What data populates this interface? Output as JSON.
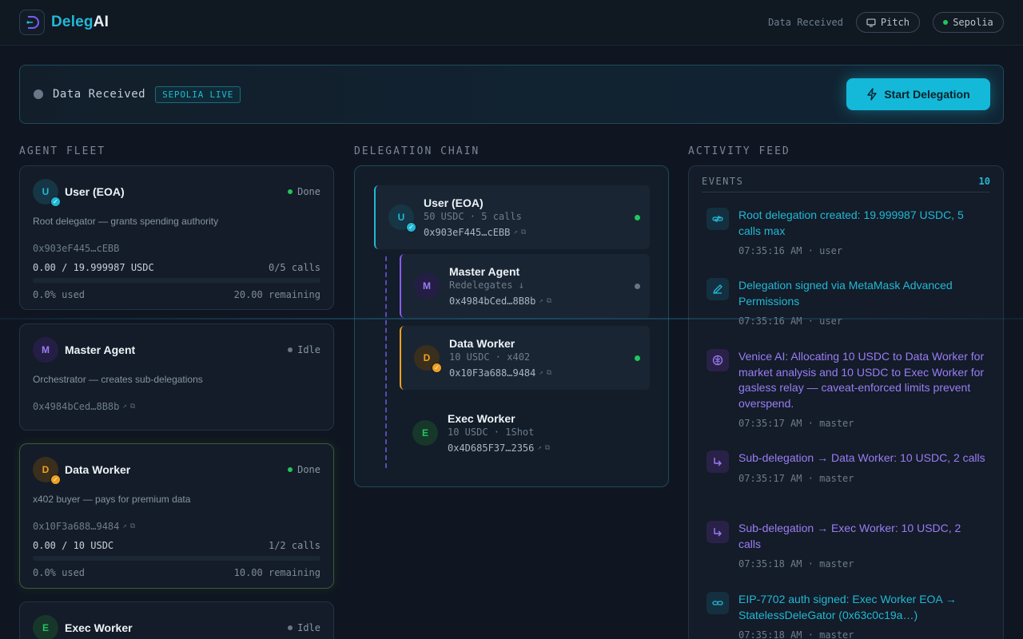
{
  "app": {
    "brand_part1": "Deleg",
    "brand_part2": "AI",
    "header_status": "Data Received",
    "pitch_label": "Pitch",
    "network_label": "Sepolia"
  },
  "status_bar": {
    "text": "Data Received",
    "badge": "SEPOLIA LIVE",
    "start_button": "Start Delegation"
  },
  "sections": {
    "fleet": "AGENT FLEET",
    "chain": "DELEGATION CHAIN",
    "feed": "ACTIVITY FEED"
  },
  "fleet": [
    {
      "initial": "U",
      "name": "User (EOA)",
      "status": "Done",
      "desc": "Root delegator — grants spending authority",
      "addr": "0x903eF445…cEBB",
      "amount": "0.00 / 19.999987 USDC",
      "calls": "0/5 calls",
      "used": "0.0% used",
      "remaining": "20.00 remaining",
      "used_fraction": 0
    },
    {
      "initial": "M",
      "name": "Master Agent",
      "status": "Idle",
      "desc": "Orchestrator — creates sub-delegations",
      "addr": "0x4984bCed…8B8b"
    },
    {
      "initial": "D",
      "name": "Data Worker",
      "status": "Done",
      "desc": "x402 buyer — pays for premium data",
      "addr": "0x10F3a688…9484",
      "amount": "0.00 / 10 USDC",
      "calls": "1/2 calls",
      "used": "0.0% used",
      "remaining": "10.00 remaining",
      "used_fraction": 0
    },
    {
      "initial": "E",
      "name": "Exec Worker",
      "status": "Idle"
    }
  ],
  "chain": [
    {
      "initial": "U",
      "name": "User (EOA)",
      "sub": "50 USDC · 5 calls",
      "addr": "0x903eF445…cEBB"
    },
    {
      "initial": "M",
      "name": "Master Agent",
      "sub": "Redelegates ↓",
      "addr": "0x4984bCed…8B8b"
    },
    {
      "initial": "D",
      "name": "Data Worker",
      "sub": "10 USDC · x402",
      "addr": "0x10F3a688…9484"
    },
    {
      "initial": "E",
      "name": "Exec Worker",
      "sub": "10 USDC · 1Shot",
      "addr": "0x4D685F37…2356"
    }
  ],
  "feed": {
    "title": "EVENTS",
    "count": "10",
    "events": [
      {
        "icon": "link-icon",
        "text": "Root delegation created: 19.999987 USDC, 5 calls max",
        "time": "07:35:16 AM · user"
      },
      {
        "icon": "pen-icon",
        "text": "Delegation signed via MetaMask Advanced Permissions",
        "time": "07:35:16 AM · user"
      },
      {
        "icon": "brain-icon",
        "text": "Venice AI: Allocating 10 USDC to Data Worker for market analysis and 10 USDC to Exec Worker for gasless relay — caveat-enforced limits prevent overspend.",
        "time": "07:35:17 AM · master"
      },
      {
        "icon": "corner-arrow-icon",
        "text": "Sub-delegation → Data Worker: 10 USDC, 2 calls",
        "time": "07:35:17 AM · master"
      },
      {
        "icon": "corner-arrow-icon",
        "text": "Sub-delegation → Exec Worker: 10 USDC, 2 calls",
        "time": "07:35:18 AM · master"
      },
      {
        "icon": "link-icon",
        "text": "EIP-7702 auth signed: Exec Worker EOA → StatelessDeleGator (0x63c0c19a…)",
        "time": "07:35:18 AM · master"
      }
    ]
  },
  "colors": {
    "accent": "#22b8d6",
    "purple": "#8b5cf6",
    "amber": "#f0a020",
    "green": "#22c55e",
    "idle": "#6b7685"
  }
}
